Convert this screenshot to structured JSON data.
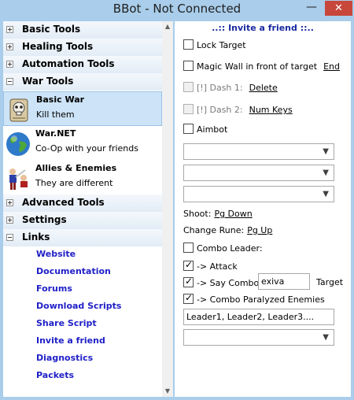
{
  "window": {
    "title": "BBot - Not Connected",
    "minimize_glyph": "—",
    "close_glyph": "✕"
  },
  "tree": {
    "groups": [
      {
        "label": "Basic Tools",
        "expanded": false
      },
      {
        "label": "Healing Tools",
        "expanded": false
      },
      {
        "label": "Automation Tools",
        "expanded": false
      },
      {
        "label": "War Tools",
        "expanded": true
      },
      {
        "label": "Advanced Tools",
        "expanded": false
      },
      {
        "label": "Settings",
        "expanded": false
      },
      {
        "label": "Links",
        "expanded": true
      }
    ],
    "war_items": [
      {
        "title": "Basic War",
        "desc": "Kill them",
        "icon": "skull-scroll-icon",
        "selected": true
      },
      {
        "title": "War.NET",
        "desc": "Co-Op with your friends",
        "icon": "globe-icon",
        "selected": false
      },
      {
        "title": "Allies & Enemies",
        "desc": "They are different",
        "icon": "fighters-icon",
        "selected": false
      }
    ],
    "links": [
      "Website",
      "Documentation",
      "Forums",
      "Download Scripts",
      "Share Script",
      "Invite a friend",
      "Diagnostics",
      "Packets"
    ]
  },
  "panel": {
    "invite": "..:: Invite a friend ::..",
    "lock_target": "Lock Target",
    "magic_wall": "Magic Wall in front of target",
    "magic_wall_key": "End",
    "dash1": "[!] Dash 1:",
    "dash1_key": "Delete",
    "dash2": "[!] Dash 2:",
    "dash2_key": "Num Keys",
    "aimbot": "Aimbot",
    "shoot_label": "Shoot:",
    "shoot_key": "Pg Down",
    "change_rune_label": "Change Rune:",
    "change_rune_key": "Pg Up",
    "combo_leader": "Combo Leader:",
    "attack": "-> Attack",
    "say_combo": "-> Say Combo",
    "say_combo_value": "exiva",
    "target_label": "Target",
    "combo_paralyzed": "-> Combo Paralyzed Enemies",
    "leaders_value": "Leader1, Leader2, Leader3....",
    "scroll_up": "▲",
    "scroll_down": "▼"
  },
  "colors": {
    "frame": "#a9cdea",
    "link": "#2020c8",
    "invite": "#1a2aa0",
    "selected": "#cde3f7"
  }
}
